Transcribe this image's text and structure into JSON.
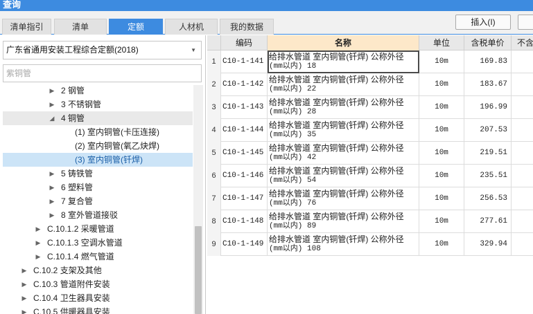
{
  "window": {
    "title": "查询"
  },
  "tabs": [
    {
      "label": "清单指引",
      "active": false
    },
    {
      "label": "清单",
      "active": false
    },
    {
      "label": "定额",
      "active": true
    },
    {
      "label": "人材机",
      "active": false
    },
    {
      "label": "我的数据",
      "active": false
    }
  ],
  "toolbar": {
    "insert_label": "插入(I)"
  },
  "library": {
    "selected": "广东省通用安装工程综合定额(2018)"
  },
  "search": {
    "value": "",
    "placeholder": "紫铜管"
  },
  "tree": [
    {
      "label": "2 钢管",
      "expander": "collapsed"
    },
    {
      "label": "3 不锈钢管",
      "expander": "collapsed"
    },
    {
      "label": "4 铜管",
      "expander": "expanded"
    },
    {
      "label": "(1) 室内铜管(卡压连接)",
      "expander": "none"
    },
    {
      "label": "(2) 室内铜管(氧乙炔焊)",
      "expander": "none"
    },
    {
      "label": "(3) 室内铜管(钎焊)",
      "expander": "none"
    },
    {
      "label": "5 铸铁管",
      "expander": "collapsed"
    },
    {
      "label": "6 塑料管",
      "expander": "collapsed"
    },
    {
      "label": "7 复合管",
      "expander": "collapsed"
    },
    {
      "label": "8 室外管道接驳",
      "expander": "collapsed"
    },
    {
      "label": "C.10.1.2 采暖管道",
      "expander": "collapsed"
    },
    {
      "label": "C.10.1.3 空调水管道",
      "expander": "collapsed"
    },
    {
      "label": "C.10.1.4 燃气管道",
      "expander": "collapsed"
    },
    {
      "label": "C.10.2 支架及其他",
      "expander": "collapsed"
    },
    {
      "label": "C.10.3 管道附件安装",
      "expander": "collapsed"
    },
    {
      "label": "C.10.4 卫生器具安装",
      "expander": "collapsed"
    },
    {
      "label": "C.10.5 供暖器具安装",
      "expander": "collapsed"
    }
  ],
  "grid": {
    "columns": [
      "编码",
      "名称",
      "单位",
      "含税单价",
      "不含"
    ],
    "rows": [
      {
        "num": "1",
        "code": "C10-1-141",
        "name1": "给排水管道 室内铜管(钎焊) 公称外径",
        "name2": "(mm以内) 18",
        "unit": "10m",
        "price": "169.83"
      },
      {
        "num": "2",
        "code": "C10-1-142",
        "name1": "给排水管道 室内铜管(钎焊) 公称外径",
        "name2": "(mm以内) 22",
        "unit": "10m",
        "price": "183.67"
      },
      {
        "num": "3",
        "code": "C10-1-143",
        "name1": "给排水管道 室内铜管(钎焊) 公称外径",
        "name2": "(mm以内) 28",
        "unit": "10m",
        "price": "196.99"
      },
      {
        "num": "4",
        "code": "C10-1-144",
        "name1": "给排水管道 室内铜管(钎焊) 公称外径",
        "name2": "(mm以内) 35",
        "unit": "10m",
        "price": "207.53"
      },
      {
        "num": "5",
        "code": "C10-1-145",
        "name1": "给排水管道 室内铜管(钎焊) 公称外径",
        "name2": "(mm以内) 42",
        "unit": "10m",
        "price": "219.51"
      },
      {
        "num": "6",
        "code": "C10-1-146",
        "name1": "给排水管道 室内铜管(钎焊) 公称外径",
        "name2": "(mm以内) 54",
        "unit": "10m",
        "price": "235.51"
      },
      {
        "num": "7",
        "code": "C10-1-147",
        "name1": "给排水管道 室内铜管(钎焊) 公称外径",
        "name2": "(mm以内) 76",
        "unit": "10m",
        "price": "256.53"
      },
      {
        "num": "8",
        "code": "C10-1-148",
        "name1": "给排水管道 室内铜管(钎焊) 公称外径",
        "name2": "(mm以内) 89",
        "unit": "10m",
        "price": "277.61"
      },
      {
        "num": "9",
        "code": "C10-1-149",
        "name1": "给排水管道 室内铜管(钎焊) 公称外径",
        "name2": "(mm以内) 108",
        "unit": "10m",
        "price": "329.94"
      }
    ]
  },
  "colors": {
    "accent": "#3d8be0",
    "selection": "#cce4f7",
    "name_header": "#fde8c9"
  }
}
